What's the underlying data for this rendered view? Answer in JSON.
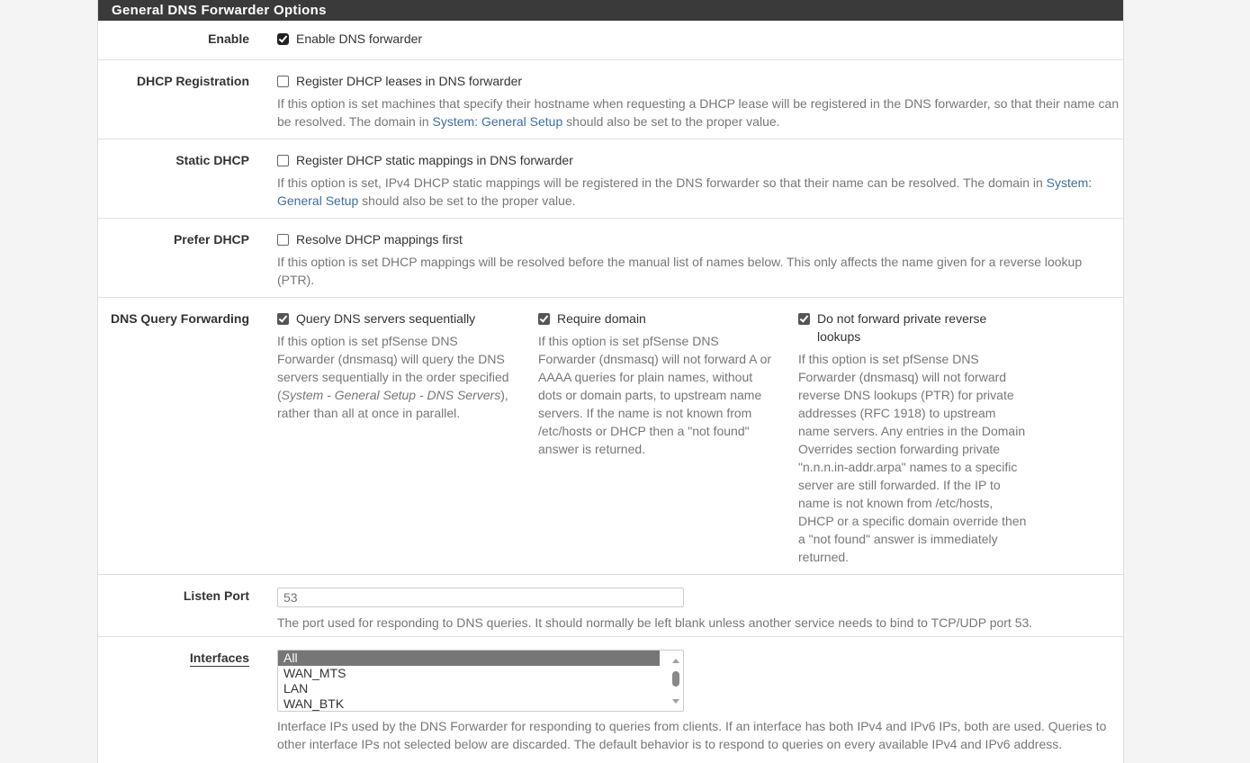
{
  "section": {
    "title": "General DNS Forwarder Options"
  },
  "rows": {
    "enable": {
      "label": "Enable",
      "checkbox_label": "Enable DNS forwarder",
      "checked": true
    },
    "dhcp_registration": {
      "label": "DHCP Registration",
      "checkbox_label": "Register DHCP leases in DNS forwarder",
      "checked": false,
      "help_before": "If this option is set machines that specify their hostname when requesting a DHCP lease will be registered in the DNS forwarder, so that their name can be resolved. The domain in ",
      "help_link": "System: General Setup",
      "help_after": " should also be set to the proper value."
    },
    "static_dhcp": {
      "label": "Static DHCP",
      "checkbox_label": "Register DHCP static mappings in DNS forwarder",
      "checked": false,
      "help_before": "If this option is set, IPv4 DHCP static mappings will be registered in the DNS forwarder so that their name can be resolved. The domain in ",
      "help_link": "System: General Setup",
      "help_after": " should also be set to the proper value."
    },
    "prefer_dhcp": {
      "label": "Prefer DHCP",
      "checkbox_label": "Resolve DHCP mappings first",
      "checked": false,
      "help": "If this option is set DHCP mappings will be resolved before the manual list of names below. This only affects the name given for a reverse lookup (PTR)."
    },
    "dns_query_forwarding": {
      "label": "DNS Query Forwarding",
      "options": [
        {
          "checkbox_label": "Query DNS servers sequentially",
          "checked": true,
          "help_before": "If this option is set pfSense DNS Forwarder (dnsmasq) will query the DNS servers sequentially in the order specified (",
          "help_italic": "System - General Setup - DNS Servers",
          "help_after": "), rather than all at once in parallel."
        },
        {
          "checkbox_label": "Require domain",
          "checked": true,
          "help": "If this option is set pfSense DNS Forwarder (dnsmasq) will not forward A or AAAA queries for plain names, without dots or domain parts, to upstream name servers. If the name is not known from /etc/hosts or DHCP then a \"not found\" answer is returned."
        },
        {
          "checkbox_label": "Do not forward private reverse lookups",
          "checked": true,
          "help": "If this option is set pfSense DNS Forwarder (dnsmasq) will not forward reverse DNS lookups (PTR) for private addresses (RFC 1918) to upstream name servers. Any entries in the Domain Overrides section forwarding private \"n.n.n.in-addr.arpa\" names to a specific server are still forwarded. If the IP to name is not known from /etc/hosts, DHCP or a specific domain override then a \"not found\" answer is immediately returned."
        }
      ]
    },
    "listen_port": {
      "label": "Listen Port",
      "value": "",
      "placeholder": "53",
      "help": "The port used for responding to DNS queries. It should normally be left blank unless another service needs to bind to TCP/UDP port 53."
    },
    "interfaces": {
      "label": "Interfaces",
      "options": [
        "All",
        "WAN_MTS",
        "LAN",
        "WAN_BTK"
      ],
      "selected": "All",
      "help_line1": "Interface IPs used by the DNS Forwarder for responding to queries from clients. If an interface has both IPv4 and IPv6 IPs, both are used. Queries to",
      "help_line2": "other interface IPs not selected below are discarded. The default behavior is to respond to queries on every available IPv4 and IPv6 address."
    }
  }
}
